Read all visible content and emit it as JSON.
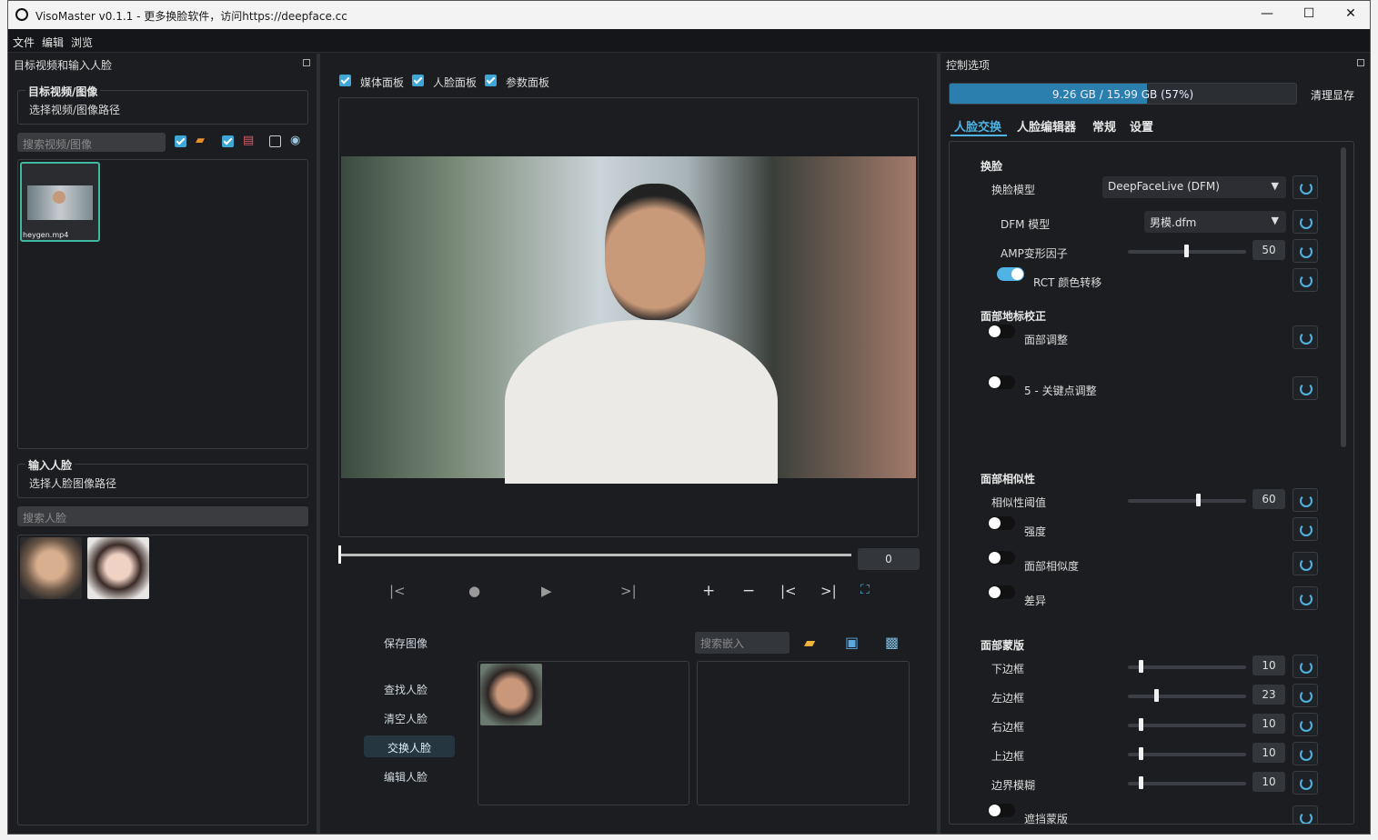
{
  "window": {
    "title": "VisoMaster v0.1.1 - 更多换脸软件，访问https://deepface.cc",
    "minimize": "—",
    "maximize": "☐",
    "close": "✕"
  },
  "menu": [
    "文件",
    "编辑",
    "浏览"
  ],
  "left": {
    "dock_title": "目标视频和输入人脸",
    "target_group": "目标视频/图像",
    "target_path": "选择视频/图像路径",
    "target_search_placeholder": "搜索视频/图像",
    "thumb_label": "heygen.mp4",
    "input_group": "输入人脸",
    "input_path": "选择人脸图像路径",
    "face_search_placeholder": "搜索人脸"
  },
  "center": {
    "panels": [
      "媒体面板",
      "人脸面板",
      "参数面板"
    ],
    "frame_number": "0",
    "save_image": "保存图像",
    "embed_search_placeholder": "搜索嵌入",
    "actions": [
      "查找人脸",
      "清空人脸",
      "交换人脸",
      "编辑人脸"
    ],
    "transport": {
      "prev": "|<",
      "record": "●",
      "play": "▶",
      "next": ">|",
      "add": "+",
      "remove": "−",
      "first": "|<",
      "last": ">|",
      "fit": "⛶"
    }
  },
  "right": {
    "dock_title": "控制选项",
    "memory": "9.26 GB / 15.99 GB (57%)",
    "memory_fraction": 0.57,
    "clear_vram": "清理显存",
    "tabs": [
      "人脸交换",
      "人脸编辑器",
      "常规",
      "设置"
    ],
    "sec_swap": "换脸",
    "swap_model_label": "换脸模型",
    "swap_model_value": "DeepFaceLive (DFM)",
    "dfm_label": "DFM 模型",
    "dfm_value": "男模.dfm",
    "amp_label": "AMP变形因子",
    "amp_value": "50",
    "rct_label": "RCT 颜色转移",
    "sec_landmark": "面部地标校正",
    "face_adjust": "面部调整",
    "kp_adjust": "5 - 关键点调整",
    "sec_similarity": "面部相似性",
    "sim_threshold_label": "相似性阈值",
    "sim_threshold_value": "60",
    "strength": "强度",
    "face_similarity": "面部相似度",
    "difference": "差异",
    "sec_mask": "面部蒙版",
    "bottom_border": "下边框",
    "bottom_value": "10",
    "left_border": "左边框",
    "left_value": "23",
    "right_border": "右边框",
    "right_value": "10",
    "top_border": "上边框",
    "top_value": "10",
    "border_blur": "边界模糊",
    "blur_value": "10",
    "last_item": "遮挡蒙版"
  },
  "colors": {
    "accent": "#4fb3e3",
    "bg": "#1d1f22",
    "panel": "#1b1d20"
  }
}
